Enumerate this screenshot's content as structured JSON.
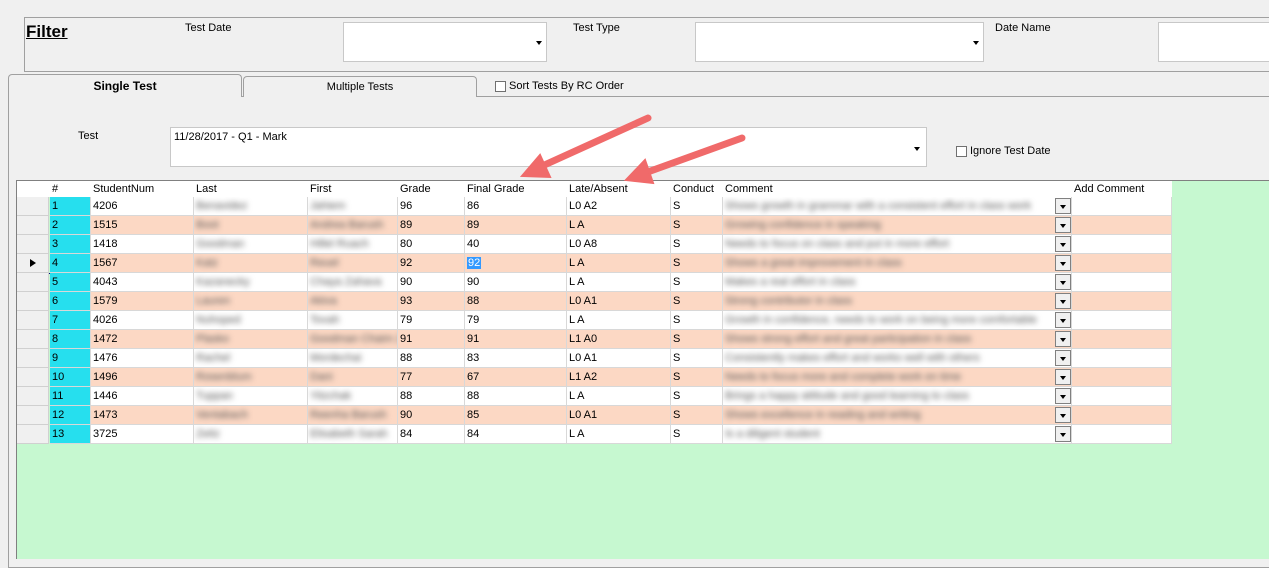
{
  "filter": {
    "title": "Filter",
    "test_date_label": "Test Date",
    "test_type_label": "Test Type",
    "date_name_label": "Date Name"
  },
  "tabs": [
    {
      "label": "Single Test"
    },
    {
      "label": "Multiple Tests"
    }
  ],
  "sort_checkbox_label": "Sort Tests By RC Order",
  "test_label": "Test",
  "test_value": "11/28/2017 - Q1 - Mark",
  "ignore_date_label": "Ignore Test Date",
  "columns": [
    "#",
    "StudentNum",
    "Last",
    "First",
    "Grade",
    "Final Grade",
    "Late/Absent",
    "Conduct",
    "Comment",
    "Add Comment"
  ],
  "rows": [
    {
      "num": "1",
      "student": "4206",
      "last": "Benavidez",
      "first": "Jahiem",
      "grade": "96",
      "final": "86",
      "late": "L0 A2",
      "conduct": "S",
      "comment": "Shows growth in grammar with a consistent effort in class work"
    },
    {
      "num": "2",
      "student": "1515",
      "last": "Boot",
      "first": "Andrea Barush",
      "grade": "89",
      "final": "89",
      "late": "L A",
      "conduct": "S",
      "comment": "Growing confidence in speaking"
    },
    {
      "num": "3",
      "student": "1418",
      "last": "Goodman",
      "first": "Hillel Ruach",
      "grade": "80",
      "final": "40",
      "late": "L0 A8",
      "conduct": "S",
      "comment": "Needs to focus on class and put in more effort"
    },
    {
      "num": "4",
      "student": "1567",
      "last": "Katz",
      "first": "Reuel",
      "grade": "92",
      "final": "92",
      "late": "L A",
      "conduct": "S",
      "comment": "Shows a great improvement in class"
    },
    {
      "num": "5",
      "student": "4043",
      "last": "Kazanecky",
      "first": "Chaya Zahava",
      "grade": "90",
      "final": "90",
      "late": "L A",
      "conduct": "S",
      "comment": "Makes a real effort in class"
    },
    {
      "num": "6",
      "student": "1579",
      "last": "Lauren",
      "first": "Akiva",
      "grade": "93",
      "final": "88",
      "late": "L0 A1",
      "conduct": "S",
      "comment": "Strong contributor in class"
    },
    {
      "num": "7",
      "student": "4026",
      "last": "Nuhoped",
      "first": "Tovah",
      "grade": "79",
      "final": "79",
      "late": "L A",
      "conduct": "S",
      "comment": "Growth in confidence, needs to work on being more comfortable"
    },
    {
      "num": "8",
      "student": "1472",
      "last": "Plasko",
      "first": "Goodman Chaim Z",
      "grade": "91",
      "final": "91",
      "late": "L1 A0",
      "conduct": "S",
      "comment": "Shows strong effort and great participation in class"
    },
    {
      "num": "9",
      "student": "1476",
      "last": "Rachel",
      "first": "Mordechai",
      "grade": "88",
      "final": "83",
      "late": "L0 A1",
      "conduct": "S",
      "comment": "Consistently makes effort and works well with others"
    },
    {
      "num": "10",
      "student": "1496",
      "last": "Rosenblum",
      "first": "Dani",
      "grade": "77",
      "final": "67",
      "late": "L1 A2",
      "conduct": "S",
      "comment": "Needs to focus more and complete work on time"
    },
    {
      "num": "11",
      "student": "1446",
      "last": "Tuppan",
      "first": "Yitzchak",
      "grade": "88",
      "final": "88",
      "late": "L A",
      "conduct": "S",
      "comment": "Brings a happy attitude and good learning to class"
    },
    {
      "num": "12",
      "student": "1473",
      "last": "Ventabach",
      "first": "Reenha Barush",
      "grade": "90",
      "final": "85",
      "late": "L0 A1",
      "conduct": "S",
      "comment": "Shows excellence in reading and writing"
    },
    {
      "num": "13",
      "student": "3725",
      "last": "Zeitz",
      "first": "Elisabeth Sarah",
      "grade": "84",
      "final": "84",
      "late": "L A",
      "conduct": "S",
      "comment": "Is a diligent student"
    }
  ],
  "colors": {
    "row_alt": "#fcd8c4",
    "num_col": "#26dfee",
    "grid_bg": "#c6f8d0",
    "annotation_arrow": "#f06a6a"
  }
}
